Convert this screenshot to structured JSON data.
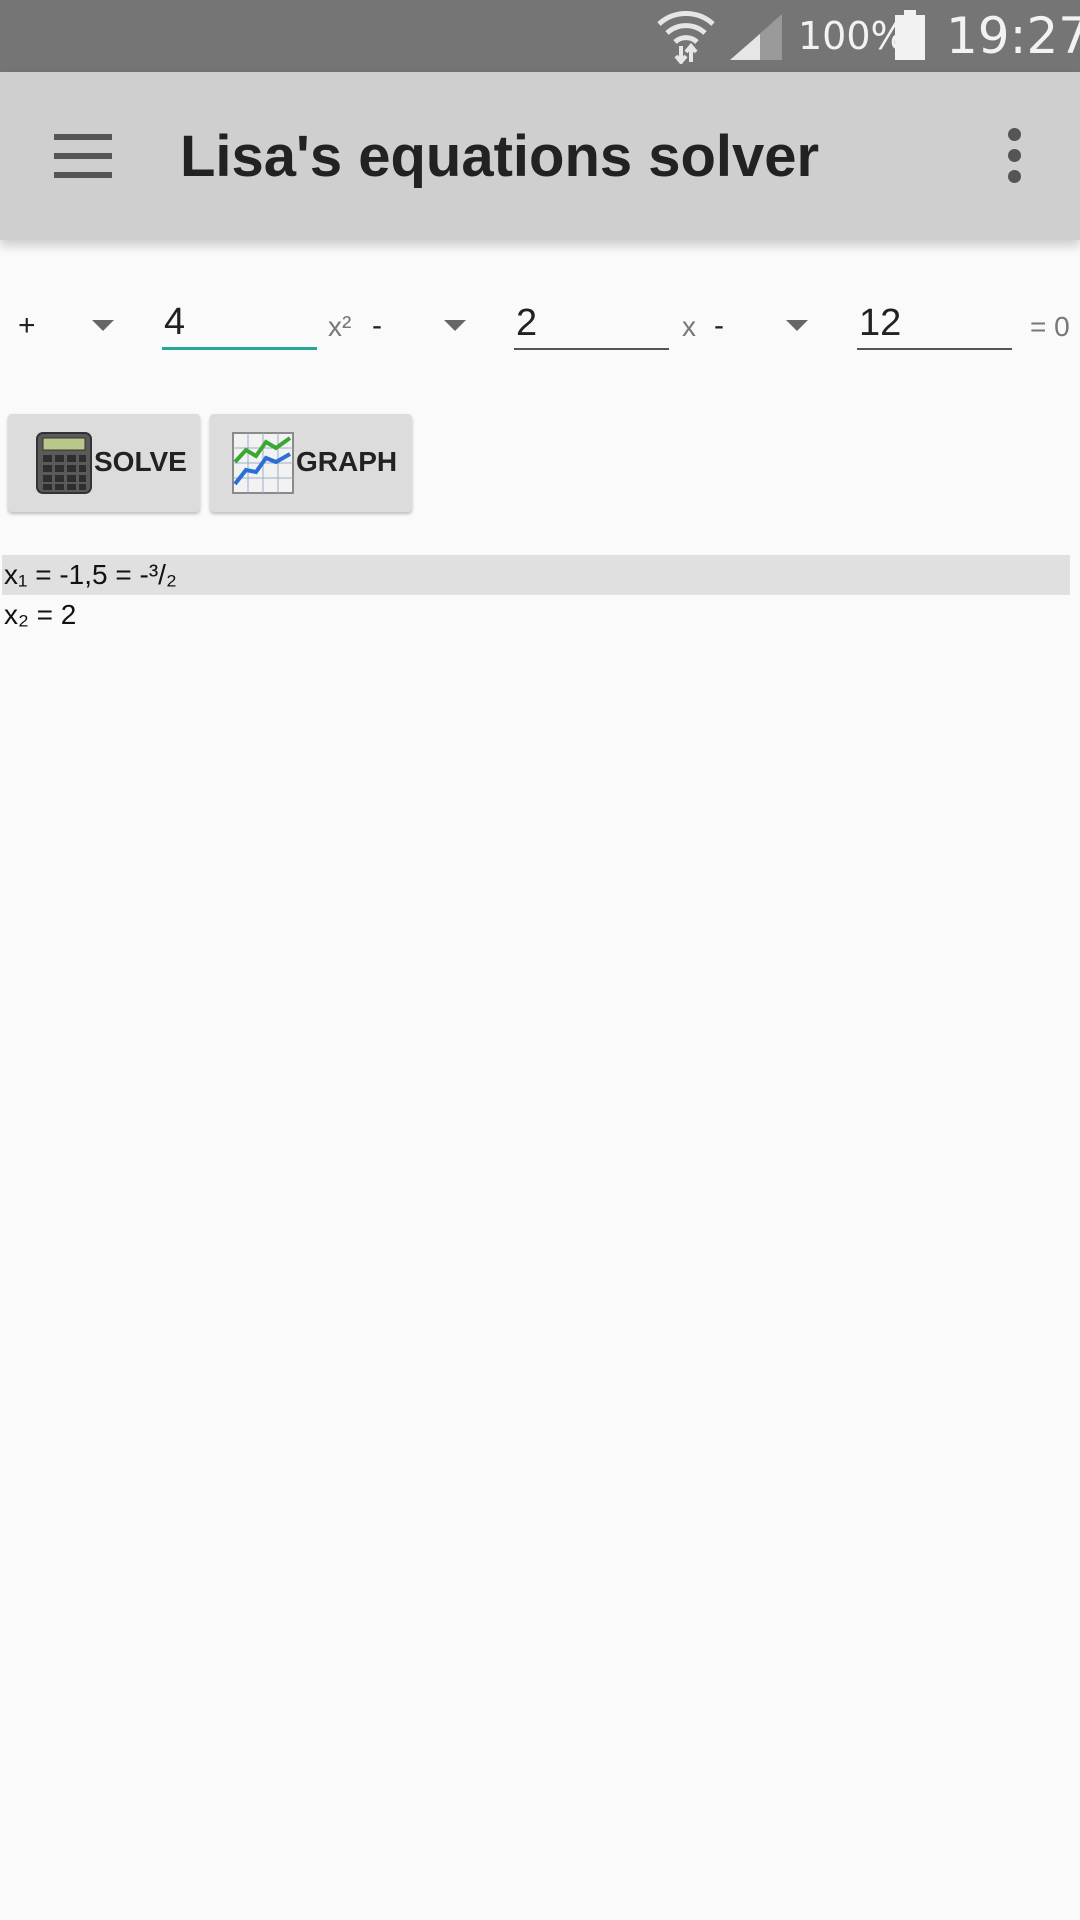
{
  "status_bar": {
    "battery_percent": "100%",
    "time": "19:27"
  },
  "app_bar": {
    "title": "Lisa's equations solver"
  },
  "equation": {
    "sign1": "+",
    "a": "4",
    "term1": "x²",
    "sign2": "-",
    "b": "2",
    "term2": "x",
    "sign3": "-",
    "c": "12",
    "rhs": "= 0"
  },
  "buttons": {
    "solve": "SOLVE",
    "graph": "GRAPH"
  },
  "results": [
    "x₁ = -1,5 = -³/₂",
    "x₂ = 2"
  ],
  "colors": {
    "status_bar": "#757575",
    "app_bar": "#cfcfcf",
    "accent": "#26a69a",
    "background": "#fafafa",
    "result_highlight": "#e0e0e0"
  },
  "icons": {
    "menu": "hamburger-menu-icon",
    "overflow": "more-vert-icon",
    "solve": "calculator-icon",
    "graph": "line-graph-icon"
  }
}
